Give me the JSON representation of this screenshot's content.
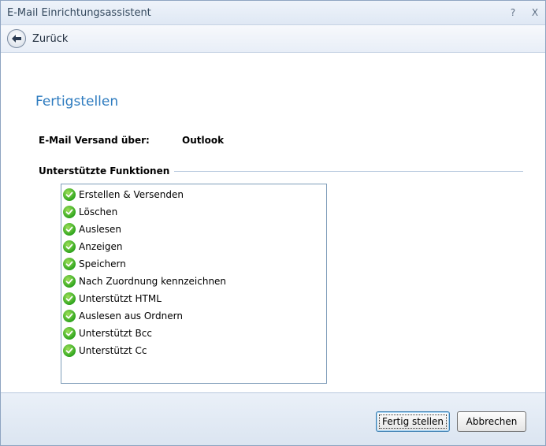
{
  "window": {
    "title": "E-Mail Einrichtungsassistent",
    "help_glyph": "?",
    "close_glyph": "X"
  },
  "nav": {
    "back_label": "Zurück",
    "back_icon": "back-arrow-icon"
  },
  "main": {
    "heading": "Fertigstellen",
    "send_via_label": "E-Mail Versand über:",
    "send_via_value": "Outlook",
    "features_group_label": "Unterstützte Funktionen",
    "features": [
      "Erstellen & Versenden",
      "Löschen",
      "Auslesen",
      "Anzeigen",
      "Speichern",
      "Nach Zuordnung kennzeichnen",
      "Unterstützt HTML",
      "Auslesen aus Ordnern",
      "Unterstützt Bcc",
      "Unterstützt Cc"
    ]
  },
  "footer": {
    "finish_label": "Fertig stellen",
    "cancel_label": "Abbrechen"
  },
  "colors": {
    "accent": "#2d7bbf",
    "check_green": "#2fa51e",
    "border_blue": "#8ea4c1"
  }
}
